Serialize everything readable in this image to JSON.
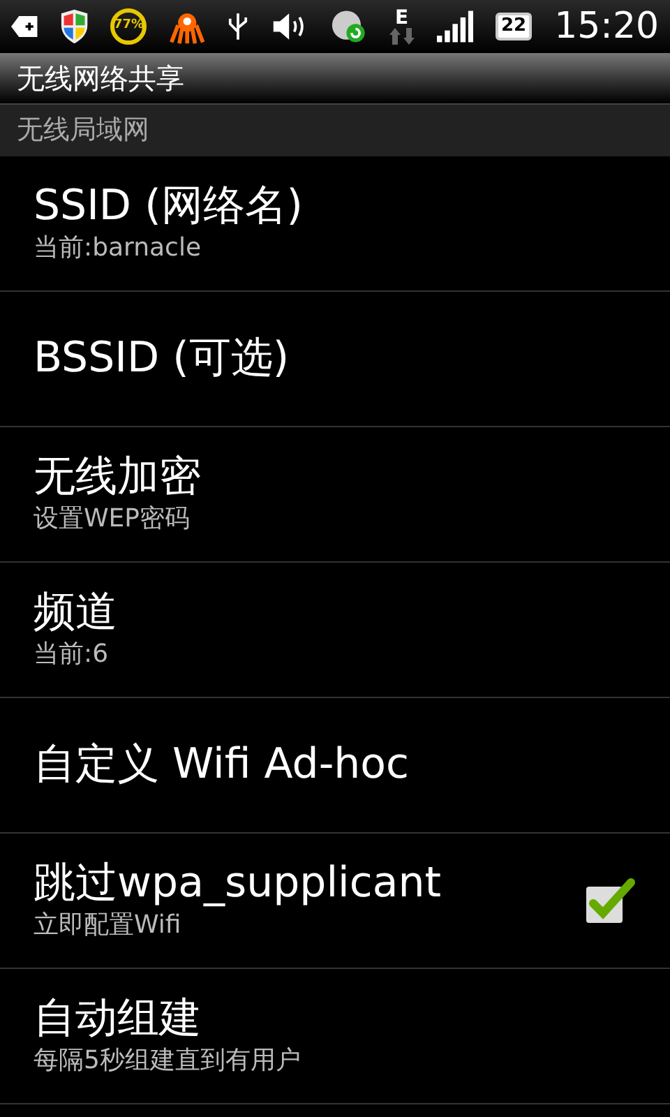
{
  "status_bar": {
    "battery_ring": "77%",
    "network_type": "E",
    "battery": "22",
    "time": "15:20"
  },
  "title": "无线网络共享",
  "category": "无线局域网",
  "items": [
    {
      "kind": "text",
      "title": "SSID (网络名)",
      "summary": "当前:barnacle"
    },
    {
      "kind": "text",
      "title": "BSSID (可选)"
    },
    {
      "kind": "text",
      "title": "无线加密",
      "summary": "设置WEP密码"
    },
    {
      "kind": "text",
      "title": "频道",
      "summary": "当前:6"
    },
    {
      "kind": "text",
      "title": "自定义 Wifi Ad-hoc"
    },
    {
      "kind": "checkbox",
      "title": "跳过wpa_supplicant",
      "summary": "立即配置Wifi",
      "checked": true
    },
    {
      "kind": "text",
      "title": "自动组建",
      "summary": "每隔5秒组建直到有用户"
    }
  ]
}
